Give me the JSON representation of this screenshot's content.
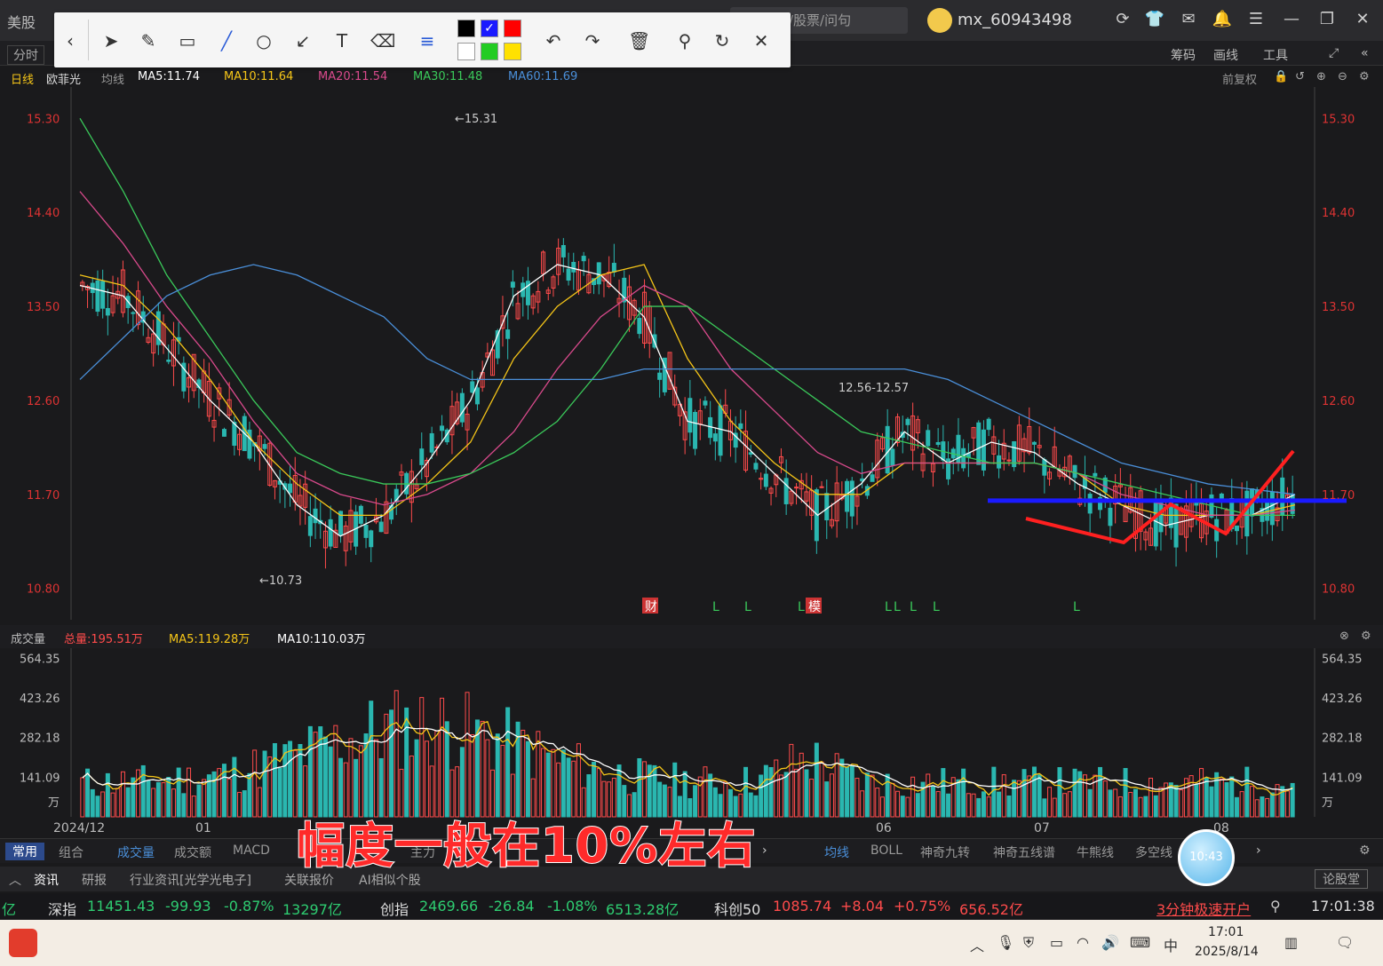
{
  "titlebar": {
    "app_tab": "美股",
    "search_text": "/股票/问句",
    "user_name": "mx_60943498",
    "icons": [
      "refresh-icon",
      "shirt-icon",
      "mail-icon",
      "bell-icon",
      "menu-icon",
      "minimize-icon",
      "restore-icon",
      "close-icon"
    ]
  },
  "bar2": {
    "tab_fenshi": "分时",
    "right_items": [
      "筹码",
      "画线",
      "工具"
    ]
  },
  "draw_toolbar": {
    "tools": [
      "back-icon",
      "pointer-icon",
      "pen-icon",
      "rect-icon",
      "line-icon",
      "circle-icon",
      "arrow-icon",
      "text-icon",
      "eraser-icon",
      "line-style-icon",
      "undo-icon",
      "redo-icon",
      "delete-icon",
      "zoom-icon",
      "rotate-icon",
      "close-icon"
    ],
    "colors": [
      "#000000",
      "#1a1aff",
      "#ff0000",
      "#ffffff",
      "#22cc22",
      "#ffe100"
    ]
  },
  "ma_legend": {
    "period": "日线",
    "stock": "欧菲光",
    "label": "均线",
    "ma5": "MA5:11.74",
    "ma10": "MA10:11.64",
    "ma20": "MA20:11.54",
    "ma30": "MA30:11.48",
    "ma60": "MA60:11.69",
    "adjust": "前复权"
  },
  "colors": {
    "ma5": "#ffffff",
    "ma10": "#f5c518",
    "ma20": "#d94a8c",
    "ma30": "#3ac95a",
    "ma60": "#4a8fd9",
    "up": "#ff4b4b",
    "down": "#2ab7b0"
  },
  "chart_data": [
    {
      "type": "candlestick",
      "y_ticks": [
        "15.30",
        "14.40",
        "13.50",
        "12.60",
        "11.70",
        "10.80"
      ],
      "ylim": [
        10.5,
        15.6
      ],
      "annotations": [
        "←15.31",
        "←10.73",
        "12.56-12.57"
      ],
      "event_markers": [
        "财",
        "L",
        "L",
        "L",
        "模",
        "L",
        "L",
        "L",
        "L",
        "L"
      ],
      "x_labels": [
        "2024/12",
        "01",
        "06",
        "07",
        "08"
      ],
      "support_line": 11.64,
      "series": [
        {
          "name": "MA5",
          "values": [
            13.7,
            13.6,
            13.1,
            12.6,
            12.2,
            11.6,
            11.3,
            11.5,
            12.0,
            12.6,
            13.6,
            13.9,
            13.8,
            13.4,
            12.4,
            12.3,
            11.9,
            11.5,
            11.8,
            12.3,
            12.0,
            12.2,
            12.1,
            11.8,
            11.6,
            11.4,
            11.5,
            11.5,
            11.7
          ]
        },
        {
          "name": "MA10",
          "values": [
            13.8,
            13.7,
            13.3,
            12.8,
            12.2,
            11.8,
            11.5,
            11.5,
            11.8,
            12.2,
            13.0,
            13.5,
            13.8,
            13.9,
            13.0,
            12.4,
            12.0,
            11.7,
            11.7,
            12.0,
            12.0,
            12.0,
            12.0,
            11.9,
            11.6,
            11.5,
            11.5,
            11.5,
            11.6
          ]
        },
        {
          "name": "MA20",
          "values": [
            14.6,
            14.1,
            13.5,
            13.0,
            12.4,
            11.9,
            11.7,
            11.6,
            11.7,
            11.9,
            12.3,
            12.9,
            13.4,
            13.7,
            13.5,
            12.9,
            12.5,
            12.1,
            11.9,
            12.0,
            12.0,
            12.0,
            12.0,
            11.9,
            11.7,
            11.6,
            11.5,
            11.5,
            11.55
          ]
        },
        {
          "name": "MA30",
          "values": [
            15.3,
            14.6,
            13.8,
            13.2,
            12.6,
            12.1,
            11.9,
            11.8,
            11.8,
            11.9,
            12.1,
            12.4,
            12.9,
            13.5,
            13.5,
            13.2,
            12.9,
            12.6,
            12.3,
            12.2,
            12.1,
            12.0,
            12.0,
            11.9,
            11.8,
            11.7,
            11.6,
            11.5,
            11.5
          ]
        },
        {
          "name": "MA60",
          "values": [
            12.8,
            13.2,
            13.6,
            13.8,
            13.9,
            13.8,
            13.6,
            13.4,
            13.0,
            12.8,
            12.8,
            12.8,
            12.8,
            12.9,
            12.9,
            12.9,
            12.9,
            12.9,
            12.9,
            12.9,
            12.8,
            12.6,
            12.4,
            12.2,
            12.0,
            11.9,
            11.8,
            11.75,
            11.7
          ]
        }
      ]
    },
    {
      "type": "bar",
      "title": "成交量",
      "total": "总量:195.51万",
      "ma5": "MA5:119.28万",
      "ma10": "MA10:110.03万",
      "y_ticks": [
        "564.35",
        "423.26",
        "282.18",
        "141.09",
        "万"
      ],
      "ylim": [
        0,
        600
      ]
    }
  ],
  "indicator_tabs": [
    "常用",
    "组合",
    "成交量",
    "成交额",
    "MACD",
    "主力",
    "均线",
    "BOLL",
    "神奇九转",
    "神奇五线谱",
    "牛熊线",
    "多空线"
  ],
  "info_tabs": [
    "资讯",
    "研报",
    "行业资讯[光学光电子]",
    "关联报价",
    "AI相似个股",
    "论股堂"
  ],
  "ticker": {
    "sz_name": "深指",
    "sz_val": "11451.43",
    "sz_chg": "-99.93",
    "sz_pct": "-0.87%",
    "sz_amt": "13297亿",
    "cy_name": "创指",
    "cy_val": "2469.66",
    "cy_chg": "-26.84",
    "cy_pct": "-1.08%",
    "cy_amt": "6513.28亿",
    "kc_name": "科创50",
    "kc_val": "1085.74",
    "kc_chg": "+8.04",
    "kc_pct": "+0.75%",
    "kc_amt": "656.52亿",
    "promo": "3分钟极速开户",
    "time": "17:01:38"
  },
  "taskbar": {
    "time": "17:01",
    "date": "2025/8/14"
  },
  "subtitle": "幅度一般在10%左右",
  "float_clock": "10:43"
}
